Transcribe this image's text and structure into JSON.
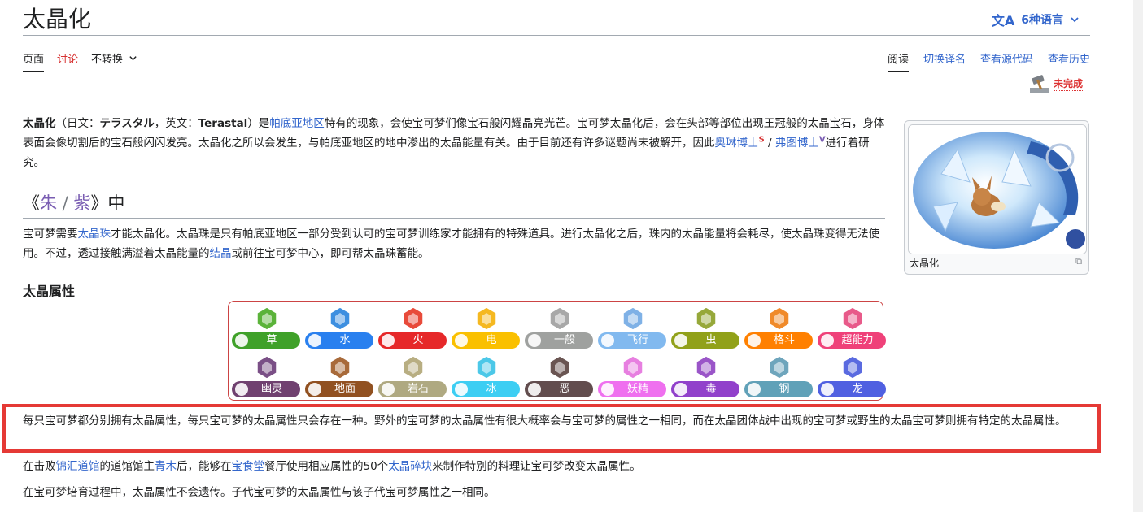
{
  "header": {
    "title": "太晶化",
    "languages": "6种语言",
    "lang_glyph": "文A"
  },
  "tabs_left": [
    {
      "label": "页面"
    },
    {
      "label": "讨论"
    },
    {
      "label": "不转换"
    }
  ],
  "tabs_right": [
    {
      "label": "阅读"
    },
    {
      "label": "切换译名"
    },
    {
      "label": "查看源代码"
    },
    {
      "label": "查看历史"
    }
  ],
  "badge": {
    "label": "未完成"
  },
  "intro": {
    "bold_term": "太晶化",
    "p1": "（日文：",
    "jp": "テラスタル",
    "p2": "，英文：",
    "en": "Terastal",
    "p3": "）是",
    "link_paldea": "帕底亚地区",
    "p4": "特有的现象，会使宝可梦们像宝石般闪耀晶亮光芒。宝可梦太晶化后，会在头部等部位出现王冠般的太晶宝石，身体表面会像切割后的宝石般闪闪发亮。太晶化之所以会发生，与帕底亚地区的地中渗出的太晶能量有关。由于目前还有许多谜题尚未被解开，因此",
    "link_sada": "奥琳博士",
    "sup_s": "S",
    "sep": " / ",
    "link_turo": "弗图博士",
    "sup_v": "V",
    "p5": "进行着研究。"
  },
  "section_sv": {
    "open": "《",
    "scarlet": "朱",
    "slash": " / ",
    "violet": "紫",
    "close": "》中"
  },
  "para_sv": {
    "t1": "宝可梦需要",
    "link_orb": "太晶珠",
    "t2": "才能太晶化。太晶珠是只有帕底亚地区一部分受到认可的宝可梦训练家才能拥有的特殊道具。进行太晶化之后，珠内的太晶能量将会耗尽，使太晶珠变得无法使用。不过，透过接触满溢着太晶能量的",
    "link_crystal": "结晶",
    "t3": "或前往宝可梦中心，即可帮太晶珠蓄能。"
  },
  "section_types": {
    "title": "太晶属性"
  },
  "types": [
    {
      "label": "草",
      "color": "#3fa129",
      "hex": "#5bb33a"
    },
    {
      "label": "水",
      "color": "#2980ef",
      "hex": "#3d8fe0"
    },
    {
      "label": "火",
      "color": "#e62829",
      "hex": "#e84a3a"
    },
    {
      "label": "电",
      "color": "#fac000",
      "hex": "#f5b820"
    },
    {
      "label": "一般",
      "color": "#9fa19f",
      "hex": "#a8a8a8"
    },
    {
      "label": "飞行",
      "color": "#81b9ef",
      "hex": "#7fb1e6"
    },
    {
      "label": "虫",
      "color": "#91a119",
      "hex": "#96a83a"
    },
    {
      "label": "格斗",
      "color": "#ff8000",
      "hex": "#f08a2a"
    },
    {
      "label": "超能力",
      "color": "#ef4179",
      "hex": "#e85a8a"
    },
    {
      "label": "幽灵",
      "color": "#704170",
      "hex": "#7a4f86"
    },
    {
      "label": "地面",
      "color": "#915121",
      "hex": "#a86a3a"
    },
    {
      "label": "岩石",
      "color": "#afa981",
      "hex": "#b8ae82"
    },
    {
      "label": "冰",
      "color": "#3dcef3",
      "hex": "#4cc8e8"
    },
    {
      "label": "恶",
      "color": "#624d4e",
      "hex": "#6a5552"
    },
    {
      "label": "妖精",
      "color": "#ef70ef",
      "hex": "#e77fe0"
    },
    {
      "label": "毒",
      "color": "#9141cb",
      "hex": "#9a55c8"
    },
    {
      "label": "钢",
      "color": "#60a1b8",
      "hex": "#6ea5bc"
    },
    {
      "label": "龙",
      "color": "#5060e1",
      "hex": "#5a6ae0"
    }
  ],
  "para_types": {
    "text": "每只宝可梦都分别拥有太晶属性，每只宝可梦的太晶属性只会存在一种。野外的宝可梦的太晶属性有很大概率会与宝可梦的属性之一相同，而在太晶团体战中出现的宝可梦或野生的太晶宝可梦则拥有特定的太晶属性。"
  },
  "para_change": {
    "t1": "在击败",
    "link_gym": "锦汇道馆",
    "t2": "的道馆馆主",
    "link_leader": "青木",
    "t3": "后，能够在",
    "link_restaurant": "宝食堂",
    "t4": "餐厅使用相应属性的50个",
    "link_shard": "太晶碎块",
    "t5": "来制作特别的料理让宝可梦改变太晶属性。"
  },
  "para_breed": {
    "text": "在宝可梦培育过程中，太晶属性不会遗传。子代宝可梦的太晶属性与该子代宝可梦属性之一相同。"
  },
  "infobox": {
    "caption": "太晶化",
    "enlarge": "⧉"
  }
}
